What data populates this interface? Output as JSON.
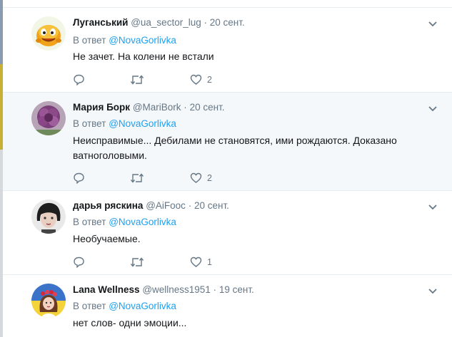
{
  "reply_prefix": "В ответ",
  "tweets": [
    {
      "name": "Луганський",
      "handle": "@ua_sector_lug",
      "date": "20 сент.",
      "reply_to": "@NovaGorlivka",
      "text": "Не зачет. На колени не встали",
      "likes": "2",
      "avatar_icon": "orange-smiley-avatar"
    },
    {
      "name": "Мария Борк",
      "handle": "@MariBork",
      "date": "20 сент.",
      "reply_to": "@NovaGorlivka",
      "text": "Неисправимые... Дебилами не становятся, ими рождаются. Доказано ватноголовыми.",
      "likes": "2",
      "avatar_icon": "purple-flower-avatar"
    },
    {
      "name": "дарья ряскина",
      "handle": "@AiFooc",
      "date": "20 сент.",
      "reply_to": "@NovaGorlivka",
      "text": "Необучаемые.",
      "likes": "1",
      "avatar_icon": "girl-portrait-avatar"
    },
    {
      "name": "Lana Wellness",
      "handle": "@wellness1951",
      "date": "19 сент.",
      "reply_to": "@NovaGorlivka",
      "text": "нет слов- одни эмоции...",
      "likes": "",
      "avatar_icon": "ukrainian-flag-girl-avatar"
    }
  ],
  "colors": {
    "link": "#1da1f2",
    "secondary_text": "#657786",
    "highlight_bg": "#f5f8fa",
    "border": "#e6ecf0"
  },
  "icons": [
    "reply-icon",
    "retweet-icon",
    "like-icon",
    "chevron-down-icon"
  ]
}
